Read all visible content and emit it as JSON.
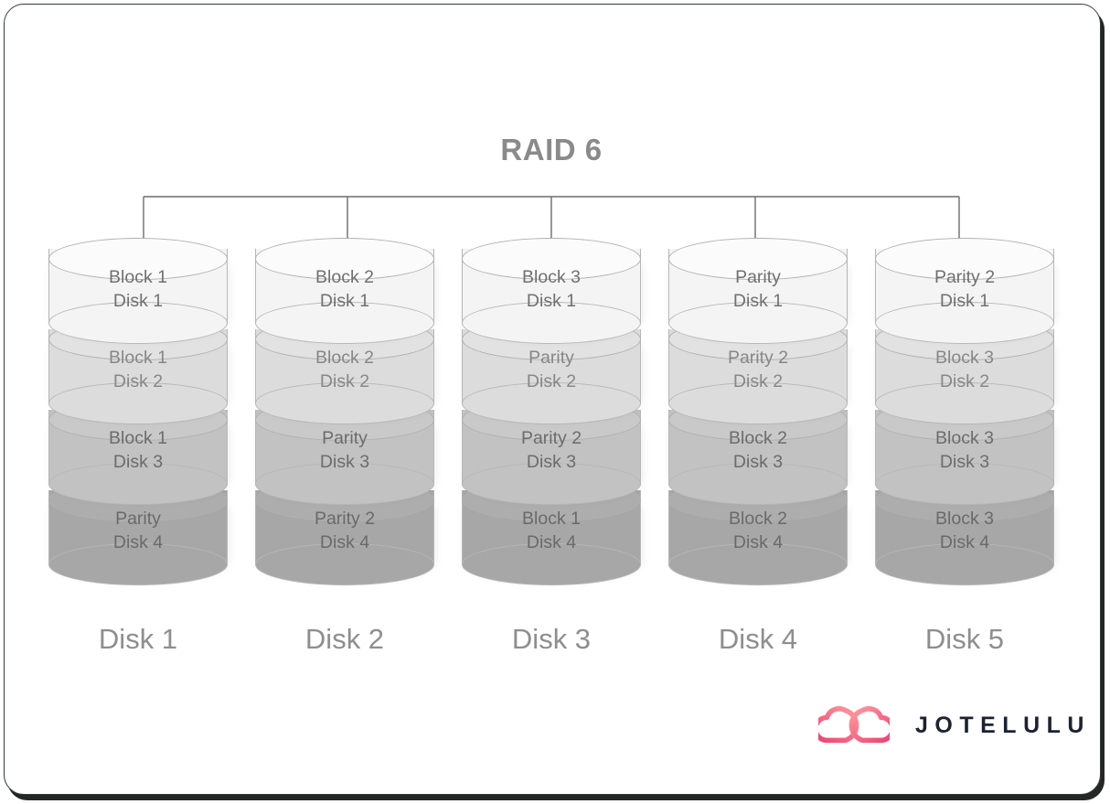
{
  "diagram": {
    "title": "RAID 6",
    "type": "raid-layout-diagram",
    "tier_labels": [
      "Disk 1",
      "Disk 2",
      "Disk 3",
      "Disk 4"
    ],
    "columns": [
      {
        "caption": "Disk 1",
        "cells": [
          {
            "block": "Block 1",
            "row": "Disk 1"
          },
          {
            "block": "Block 1",
            "row": "Disk 2"
          },
          {
            "block": "Block 1",
            "row": "Disk 3"
          },
          {
            "block": "Parity",
            "row": "Disk 4"
          }
        ]
      },
      {
        "caption": "Disk 2",
        "cells": [
          {
            "block": "Block 2",
            "row": "Disk 1"
          },
          {
            "block": "Block 2",
            "row": "Disk 2"
          },
          {
            "block": "Parity",
            "row": "Disk 3"
          },
          {
            "block": "Parity 2",
            "row": "Disk 4"
          }
        ]
      },
      {
        "caption": "Disk 3",
        "cells": [
          {
            "block": "Block 3",
            "row": "Disk 1"
          },
          {
            "block": "Parity",
            "row": "Disk 2"
          },
          {
            "block": "Parity 2",
            "row": "Disk 3"
          },
          {
            "block": "Block 1",
            "row": "Disk 4"
          }
        ]
      },
      {
        "caption": "Disk 4",
        "cells": [
          {
            "block": "Parity",
            "row": "Disk 1"
          },
          {
            "block": "Parity 2",
            "row": "Disk 2"
          },
          {
            "block": "Block 2",
            "row": "Disk 3"
          },
          {
            "block": "Block 2",
            "row": "Disk 4"
          }
        ]
      },
      {
        "caption": "Disk 5",
        "cells": [
          {
            "block": "Parity 2",
            "row": "Disk 1"
          },
          {
            "block": "Block 3",
            "row": "Disk 2"
          },
          {
            "block": "Block 3",
            "row": "Disk 3"
          },
          {
            "block": "Block 3",
            "row": "Disk 4"
          }
        ]
      }
    ]
  },
  "logo": {
    "wordmark": "JOTELULU",
    "mark_name": "jotelulu-cloud-logo",
    "mark_color_light": "#ff8f9e",
    "mark_color_dark": "#ef3f74",
    "wordmark_color": "#1c2233"
  },
  "colors": {
    "card_border": "#2e3f33",
    "title_text": "#8a8a8a",
    "caption_text": "#8e8e8e",
    "cylinder_tier_1": "#f4f4f4",
    "cylinder_tier_2": "#dcdcdc",
    "cylinder_tier_3": "#c2c2c2",
    "cylinder_tier_4": "#a7a7a7",
    "connector_line": "#6b6b6b"
  }
}
